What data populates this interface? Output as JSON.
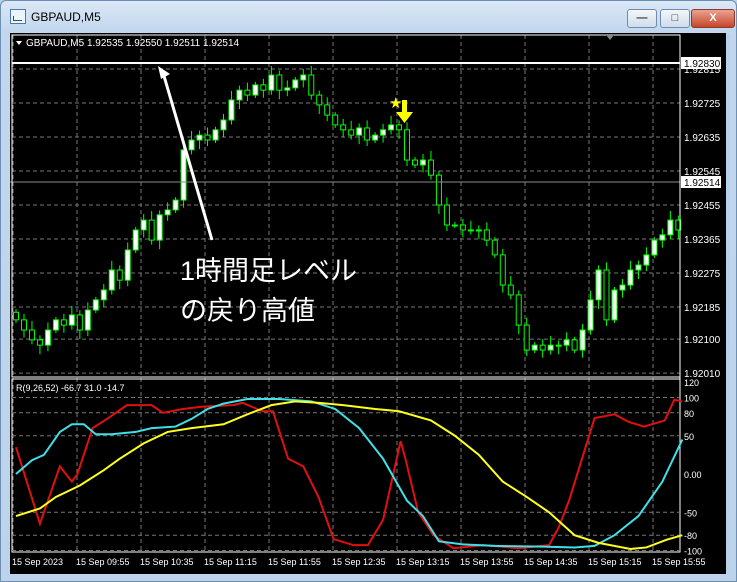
{
  "window": {
    "title": "GBPAUD,M5",
    "minimize": "—",
    "maximize": "□",
    "close": "X"
  },
  "chart": {
    "header": "GBPAUD,M5  1.92535 1.92550 1.92511 1.92514",
    "symbol": "GBPAUD",
    "timeframe": "M5",
    "ohlc": {
      "open": 1.92535,
      "high": 1.9255,
      "low": 1.92511,
      "close": 1.92514
    },
    "price_labels": [
      "1.92815",
      "1.92725",
      "1.92635",
      "1.92545",
      "1.92455",
      "1.92365",
      "1.92275",
      "1.92185",
      "1.92100",
      "1.92010"
    ],
    "price_values": [
      1.92815,
      1.92725,
      1.92635,
      1.92545,
      1.92455,
      1.92365,
      1.92275,
      1.92185,
      1.921,
      1.9201
    ],
    "hline_label": "1.92830",
    "hline_value": 1.9283,
    "current_label": "1.92514",
    "current_value": 1.92514,
    "annotation_line1": "1時間足レベル",
    "annotation_line2": "の戻り高値",
    "closes": [
      1.92151,
      1.92124,
      1.92098,
      1.92084,
      1.92124,
      1.92151,
      1.92137,
      1.92164,
      1.92124,
      1.92177,
      1.92204,
      1.9223,
      1.92283,
      1.92256,
      1.92336,
      1.92389,
      1.92415,
      1.92362,
      1.92429,
      1.92442,
      1.92468,
      1.92601,
      1.92627,
      1.9264,
      1.92627,
      1.92654,
      1.9268,
      1.92733,
      1.92759,
      1.92746,
      1.92773,
      1.92759,
      1.92799,
      1.92759,
      1.92765,
      1.92786,
      1.92799,
      1.92746,
      1.9272,
      1.92693,
      1.92667,
      1.92654,
      1.9264,
      1.92659,
      1.92627,
      1.9264,
      1.92654,
      1.92667,
      1.92654,
      1.92574,
      1.92561,
      1.92574,
      1.92534,
      1.92455,
      1.92402,
      1.92402,
      1.92389,
      1.92389,
      1.92389,
      1.92362,
      1.92323,
      1.92243,
      1.92217,
      1.92137,
      1.92071,
      1.92084,
      1.92071,
      1.92084,
      1.92084,
      1.92098,
      1.92071,
      1.92124,
      1.92204,
      1.92283,
      1.92151,
      1.9223,
      1.92243,
      1.92283,
      1.92296,
      1.92323,
      1.92362,
      1.92376,
      1.92415,
      1.92389
    ],
    "colors": {
      "candle": "#00ff00",
      "bull_fill": "#ffffff",
      "grid": "#8a8a8a",
      "annotation": "#ffffff",
      "signal": "#ffff00"
    }
  },
  "indicator": {
    "label": "R(9,26,52) -66.7 31.0 -14.7",
    "axis_labels": [
      "120",
      "100",
      "80",
      "50",
      "0.00",
      "-50",
      "-80",
      "-100"
    ],
    "axis_values": [
      120,
      100,
      80,
      50,
      0,
      -50,
      -80,
      -100
    ],
    "series": [
      {
        "name": "fast",
        "color": "#e01010",
        "points": [
          [
            0,
            35
          ],
          [
            3,
            -65
          ],
          [
            5.5,
            10
          ],
          [
            7,
            -10
          ],
          [
            7.7,
            0
          ],
          [
            9.6,
            60
          ],
          [
            11.4,
            72
          ],
          [
            13.9,
            90
          ],
          [
            17,
            90
          ],
          [
            18.4,
            80
          ],
          [
            20.9,
            85
          ],
          [
            23.4,
            88
          ],
          [
            27.2,
            90
          ],
          [
            28.4,
            93
          ],
          [
            30.9,
            82
          ],
          [
            32.2,
            82
          ],
          [
            34.1,
            20
          ],
          [
            36,
            10
          ],
          [
            37.9,
            -30
          ],
          [
            39.8,
            -85
          ],
          [
            42.3,
            -93
          ],
          [
            44.1,
            -93
          ],
          [
            46,
            -60
          ],
          [
            48.2,
            43
          ],
          [
            48.8,
            20
          ],
          [
            50.4,
            -50
          ],
          [
            52.3,
            -80
          ],
          [
            54.8,
            -97
          ],
          [
            58.6,
            -93
          ],
          [
            63,
            -97
          ],
          [
            66.8,
            -93
          ],
          [
            68,
            -70
          ],
          [
            69.3,
            -35
          ],
          [
            72.5,
            73
          ],
          [
            75,
            78
          ],
          [
            76.8,
            68
          ],
          [
            78.7,
            62
          ],
          [
            81.3,
            70
          ],
          [
            82.5,
            97
          ],
          [
            83.5,
            95
          ]
        ]
      },
      {
        "name": "mid",
        "color": "#40e0e8",
        "points": [
          [
            0,
            0
          ],
          [
            2,
            18
          ],
          [
            3.5,
            25
          ],
          [
            5.5,
            55
          ],
          [
            7,
            65
          ],
          [
            8.5,
            65
          ],
          [
            10,
            52
          ],
          [
            12,
            52
          ],
          [
            15,
            55
          ],
          [
            17,
            60
          ],
          [
            20,
            62
          ],
          [
            22,
            72
          ],
          [
            24,
            85
          ],
          [
            26,
            92
          ],
          [
            29,
            98
          ],
          [
            33,
            98
          ],
          [
            37,
            95
          ],
          [
            40,
            85
          ],
          [
            43,
            60
          ],
          [
            46,
            20
          ],
          [
            49,
            -35
          ],
          [
            51,
            -55
          ],
          [
            53,
            -88
          ],
          [
            56,
            -92
          ],
          [
            60,
            -94
          ],
          [
            66,
            -95
          ],
          [
            70,
            -96
          ],
          [
            72.5,
            -94
          ],
          [
            75,
            -80
          ],
          [
            78,
            -55
          ],
          [
            81,
            -10
          ],
          [
            83.5,
            45
          ]
        ]
      },
      {
        "name": "slow",
        "color": "#ffff20",
        "points": [
          [
            0,
            -55
          ],
          [
            3,
            -45
          ],
          [
            5,
            -30
          ],
          [
            8,
            -15
          ],
          [
            11,
            5
          ],
          [
            13,
            20
          ],
          [
            16,
            40
          ],
          [
            19,
            55
          ],
          [
            22,
            60
          ],
          [
            26,
            65
          ],
          [
            29,
            78
          ],
          [
            32,
            90
          ],
          [
            35,
            95
          ],
          [
            38,
            93
          ],
          [
            41,
            90
          ],
          [
            45,
            85
          ],
          [
            48,
            82
          ],
          [
            52,
            70
          ],
          [
            55,
            50
          ],
          [
            58,
            25
          ],
          [
            61,
            -10
          ],
          [
            64,
            -30
          ],
          [
            66.8,
            -50
          ],
          [
            70,
            -80
          ],
          [
            73,
            -90
          ],
          [
            77,
            -98
          ],
          [
            79,
            -96
          ],
          [
            81.5,
            -86
          ],
          [
            83.5,
            -80
          ]
        ]
      }
    ]
  },
  "time_labels": [
    "15 Sep 2023",
    "15 Sep 09:55",
    "15 Sep 10:35",
    "15 Sep 11:15",
    "15 Sep 11:55",
    "15 Sep 12:35",
    "15 Sep 13:15",
    "15 Sep 13:55",
    "15 Sep 14:35",
    "15 Sep 15:15",
    "15 Sep 15:55"
  ]
}
